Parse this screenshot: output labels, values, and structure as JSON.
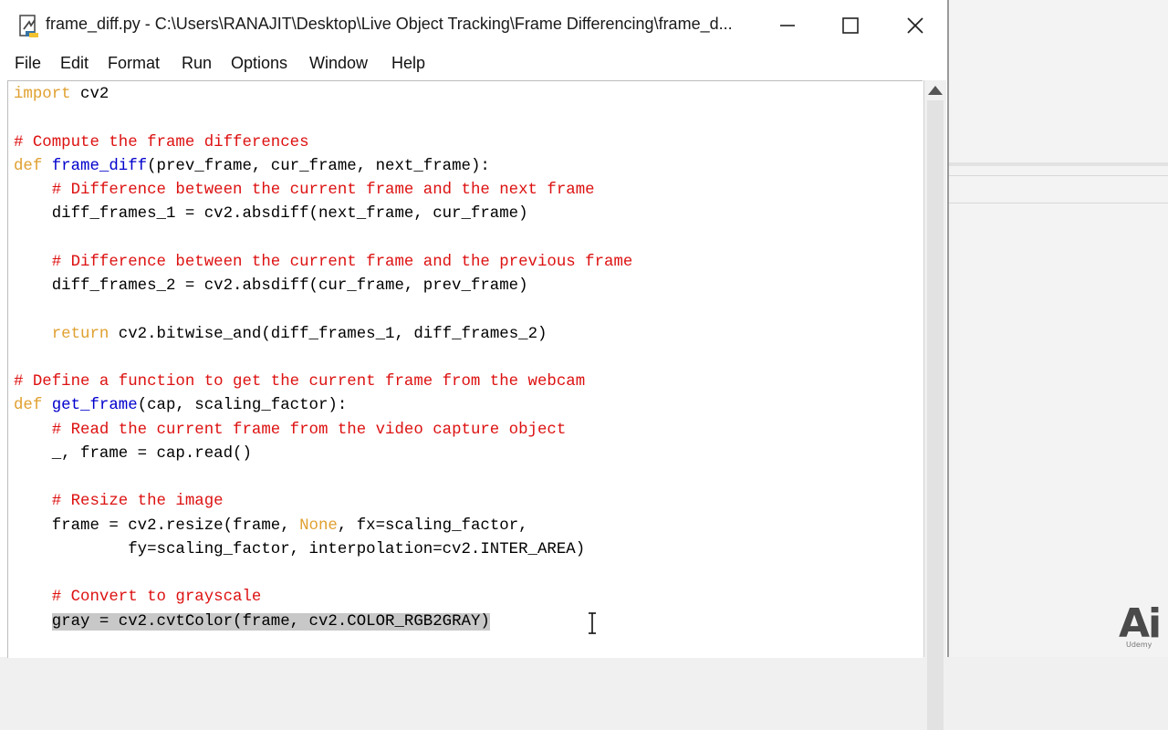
{
  "window": {
    "title": "frame_diff.py - C:\\Users\\RANAJIT\\Desktop\\Live Object Tracking\\Frame Differencing\\frame_d..."
  },
  "menu": [
    "File",
    "Edit",
    "Format",
    "Run",
    "Options",
    "Window",
    "Help"
  ],
  "icons": {
    "app": "python-file-icon",
    "minimize": "minimize-icon",
    "maximize": "maximize-icon",
    "close": "close-icon",
    "scroll_up": "scroll-up-arrow-icon",
    "cursor": "text-cursor-icon"
  },
  "colors": {
    "keyword": "#e0a030",
    "comment": "#dd1111",
    "function_name": "#0000cc",
    "selection": "#c8c8c8"
  },
  "code": {
    "lines": [
      [
        {
          "t": "kw",
          "v": "import"
        },
        {
          "t": "n",
          "v": " cv2"
        }
      ],
      [],
      [
        {
          "t": "cm",
          "v": "# Compute the frame differences"
        }
      ],
      [
        {
          "t": "kw",
          "v": "def"
        },
        {
          "t": "n",
          "v": " "
        },
        {
          "t": "fn",
          "v": "frame_diff"
        },
        {
          "t": "n",
          "v": "(prev_frame, cur_frame, next_frame):"
        }
      ],
      [
        {
          "t": "n",
          "v": "    "
        },
        {
          "t": "cm",
          "v": "# Difference between the current frame and the next frame"
        }
      ],
      [
        {
          "t": "n",
          "v": "    diff_frames_1 = cv2.absdiff(next_frame, cur_frame)"
        }
      ],
      [],
      [
        {
          "t": "n",
          "v": "    "
        },
        {
          "t": "cm",
          "v": "# Difference between the current frame and the previous frame"
        }
      ],
      [
        {
          "t": "n",
          "v": "    diff_frames_2 = cv2.absdiff(cur_frame, prev_frame)"
        }
      ],
      [],
      [
        {
          "t": "n",
          "v": "    "
        },
        {
          "t": "kw",
          "v": "return"
        },
        {
          "t": "n",
          "v": " cv2.bitwise_and(diff_frames_1, diff_frames_2)"
        }
      ],
      [],
      [
        {
          "t": "cm",
          "v": "# Define a function to get the current frame from the webcam"
        }
      ],
      [
        {
          "t": "kw",
          "v": "def"
        },
        {
          "t": "n",
          "v": " "
        },
        {
          "t": "fn",
          "v": "get_frame"
        },
        {
          "t": "n",
          "v": "(cap, scaling_factor):"
        }
      ],
      [
        {
          "t": "n",
          "v": "    "
        },
        {
          "t": "cm",
          "v": "# Read the current frame from the video capture object"
        }
      ],
      [
        {
          "t": "n",
          "v": "    _, frame = cap.read()"
        }
      ],
      [],
      [
        {
          "t": "n",
          "v": "    "
        },
        {
          "t": "cm",
          "v": "# Resize the image"
        }
      ],
      [
        {
          "t": "n",
          "v": "    frame = cv2.resize(frame, "
        },
        {
          "t": "kw",
          "v": "None"
        },
        {
          "t": "n",
          "v": ", fx=scaling_factor,"
        }
      ],
      [
        {
          "t": "n",
          "v": "            fy=scaling_factor, interpolation=cv2.INTER_AREA)"
        }
      ],
      [],
      [
        {
          "t": "n",
          "v": "    "
        },
        {
          "t": "cm",
          "v": "# Convert to grayscale"
        }
      ],
      [
        {
          "t": "n",
          "v": "    "
        },
        {
          "t": "sel",
          "v": "gray = cv2.cvtColor(frame, cv2.COLOR_RGB2GRAY)"
        }
      ]
    ]
  },
  "watermark": {
    "logo": "Ai",
    "sub": "Udemy"
  }
}
